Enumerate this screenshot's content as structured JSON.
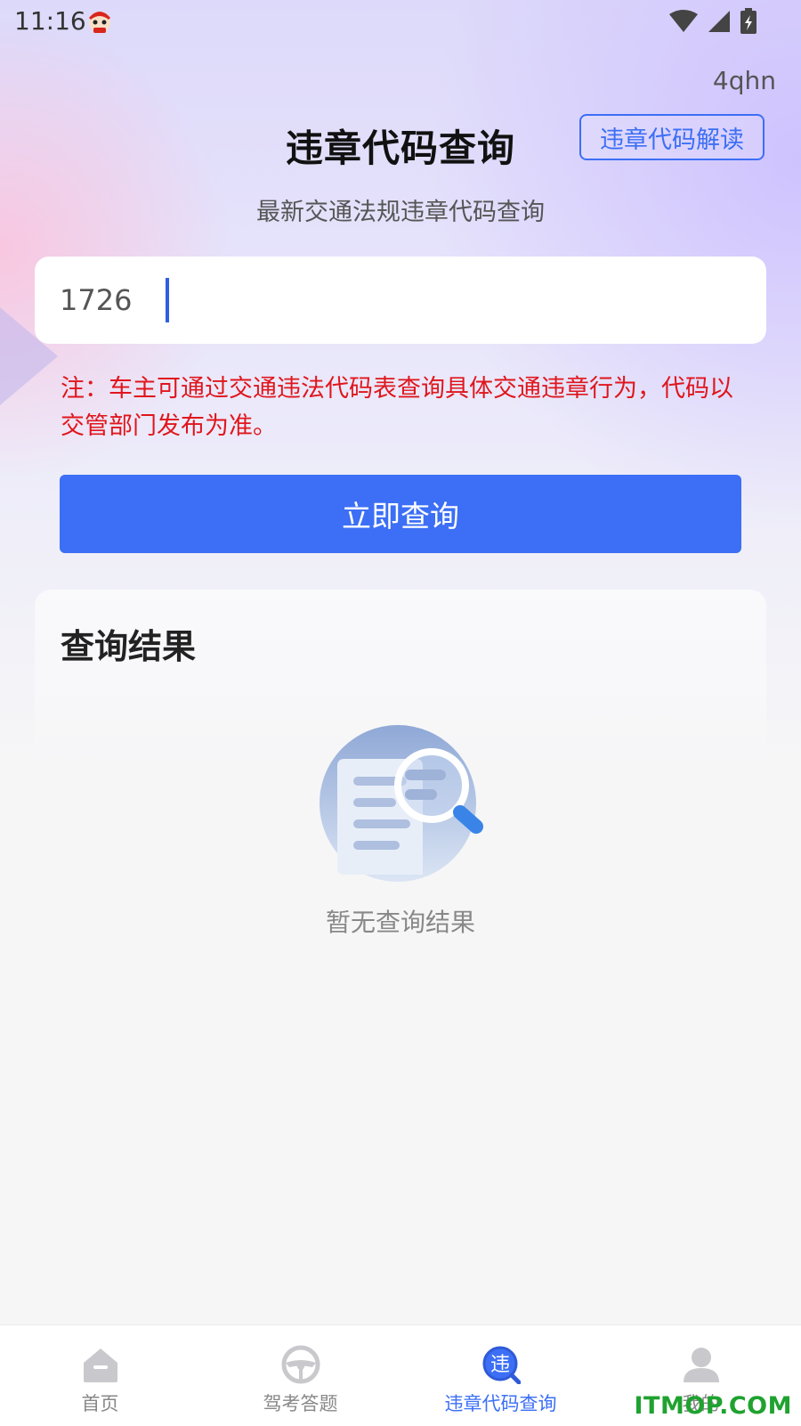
{
  "status_bar": {
    "time": "11:16"
  },
  "header": {
    "code_label": "4qhn",
    "title": "违章代码查询",
    "explain_button": "违章代码解读",
    "subtitle": "最新交通法规违章代码查询"
  },
  "search": {
    "value": "1726"
  },
  "note": "注：车主可通过交通违法代码表查询具体交通违章行为，代码以交管部门发布为准。",
  "query_button": "立即查询",
  "result": {
    "title": "查询结果",
    "empty_text": "暂无查询结果"
  },
  "tabbar": {
    "active_index": 2,
    "active_color": "#3c6ff5",
    "inactive_color": "#888888",
    "items": [
      {
        "label": "首页",
        "icon": "home-icon"
      },
      {
        "label": "驾考答题",
        "icon": "steering-wheel-icon"
      },
      {
        "label": "违章代码查询",
        "icon": "violation-search-icon",
        "icon_text": "违"
      },
      {
        "label": "我的",
        "icon": "user-icon"
      }
    ]
  },
  "watermark": "ITMOP.COM",
  "colors": {
    "accent": "#3c6ff5",
    "note_red": "#e0161d"
  }
}
